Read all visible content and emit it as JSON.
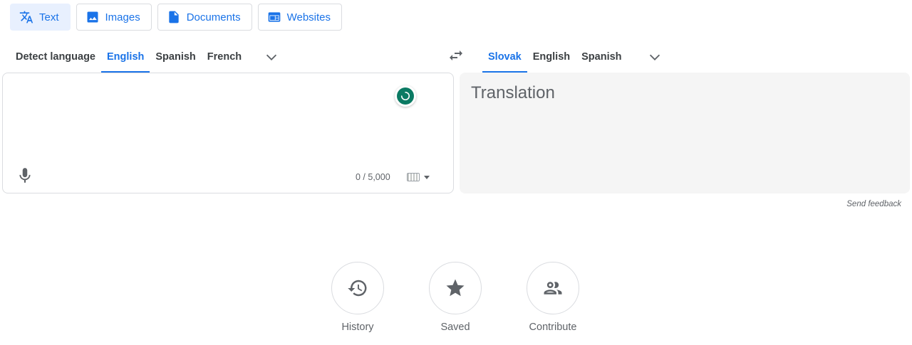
{
  "mode_tabs": [
    {
      "label": "Text",
      "icon": "translate-icon",
      "active": true
    },
    {
      "label": "Images",
      "icon": "image-icon",
      "active": false
    },
    {
      "label": "Documents",
      "icon": "document-icon",
      "active": false
    },
    {
      "label": "Websites",
      "icon": "website-icon",
      "active": false
    }
  ],
  "source_langs": [
    "Detect language",
    "English",
    "Spanish",
    "French"
  ],
  "source_active": "English",
  "target_langs": [
    "Slovak",
    "English",
    "Spanish"
  ],
  "target_active": "Slovak",
  "source_panel": {
    "char_count": "0 / 5,000"
  },
  "target_panel": {
    "placeholder": "Translation"
  },
  "feedback_label": "Send feedback",
  "bottom_actions": [
    {
      "label": "History",
      "icon": "history-icon"
    },
    {
      "label": "Saved",
      "icon": "star-icon"
    },
    {
      "label": "Contribute",
      "icon": "people-icon"
    }
  ],
  "colors": {
    "accent": "#1a73e8",
    "active_tab_bg": "#e8f0fe",
    "spinner": "#0b7a63",
    "target_bg": "#f5f5f5"
  }
}
